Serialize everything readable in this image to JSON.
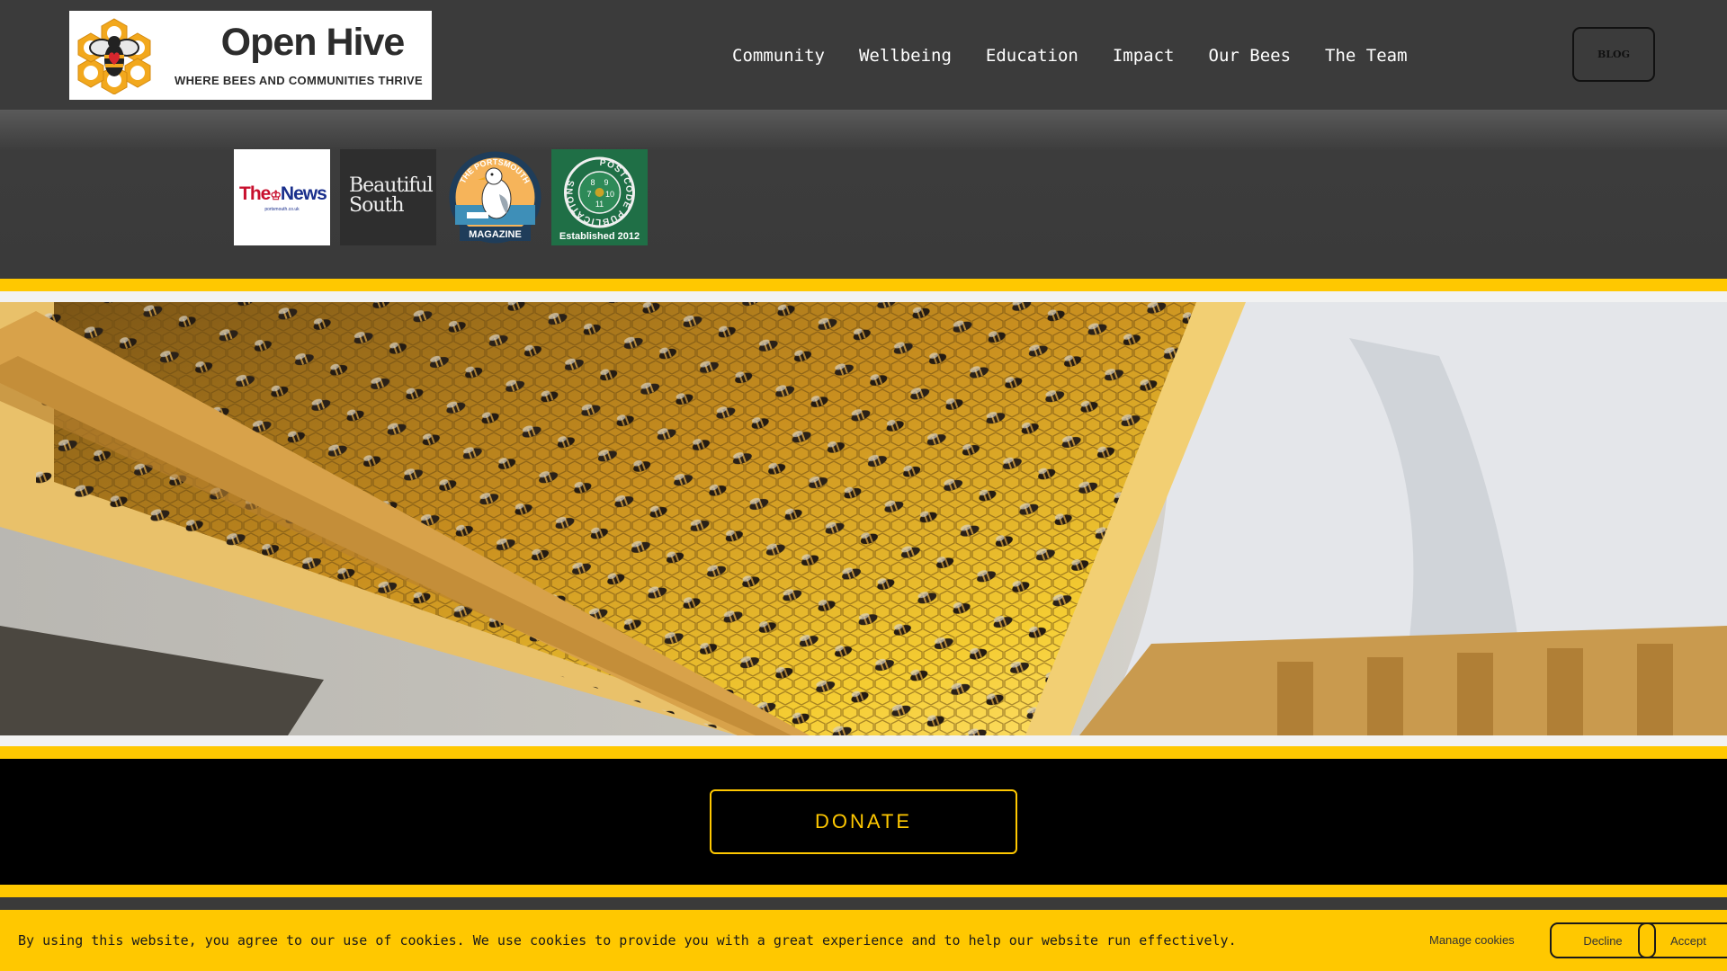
{
  "brand": {
    "title": "Open Hive",
    "tagline": "WHERE BEES AND COMMUNITIES THRIVE"
  },
  "nav": {
    "items": [
      "Community",
      "Wellbeing",
      "Education",
      "Impact",
      "Our Bees",
      "The Team"
    ],
    "blog_label": "BLOG"
  },
  "press": {
    "news_title_pre": "The",
    "news_title_post": "News",
    "news_url": "portsmouth.co.uk",
    "beautiful_south_line1": "Beautiful",
    "beautiful_south_line2": "South",
    "portsmouth_top": "THE PORTSMOUTH",
    "portsmouth_bottom": "MAGAZINE",
    "postcode_ring": "POSTCODE PUBLICATIONS",
    "postcode_established": "Established 2012",
    "postcode_numbers": [
      "8",
      "9",
      "7",
      "10",
      "11"
    ]
  },
  "donate": {
    "label": "DONATE"
  },
  "cookie": {
    "text": "By using this website, you agree to our use of cookies. We use cookies to provide you with a great experience and to help our website run effectively.",
    "manage_label": "Manage cookies",
    "decline_label": "Decline",
    "accept_label": "Accept"
  },
  "colors": {
    "accent_yellow": "#ffc800",
    "header_bg": "#3b3b3b",
    "donate_bg": "#000000"
  },
  "icons": {
    "logo": "honeycomb-bee-icon",
    "hero": "beehive-frame-image"
  }
}
